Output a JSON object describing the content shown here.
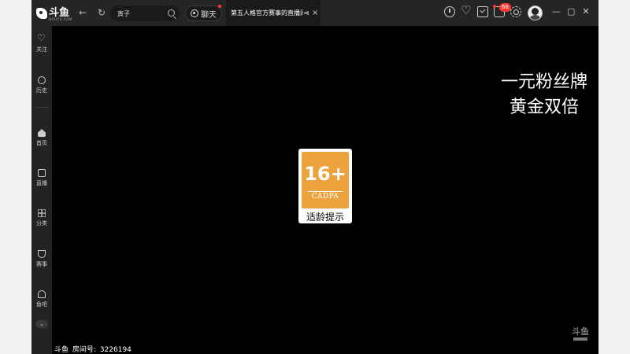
{
  "app": {
    "logo_text": "斗鱼",
    "logo_sub": "DOUYU.COM"
  },
  "nav": {
    "back_icon": "arrow-left",
    "refresh_icon": "refresh"
  },
  "search": {
    "value": "寅子",
    "icon": "search-icon"
  },
  "chat": {
    "label": "聊天"
  },
  "tab": {
    "title": "第五人格官方赛事的直播间",
    "close": "×"
  },
  "toolbar": {
    "icons": [
      "clock-icon",
      "heart-icon",
      "task-icon",
      "message-icon",
      "gear-icon"
    ],
    "message_badge": "66"
  },
  "window_controls": {
    "minimize": "—",
    "maximize": "▢",
    "close": "✕"
  },
  "sidebar": {
    "items": [
      {
        "label": "关注",
        "icon": "heart-icon"
      },
      {
        "label": "历史",
        "icon": "clock-icon"
      },
      {
        "label": "首页",
        "icon": "home-icon"
      },
      {
        "label": "直播",
        "icon": "tv-icon"
      },
      {
        "label": "分类",
        "icon": "grid-icon"
      },
      {
        "label": "赛事",
        "icon": "trophy-icon"
      },
      {
        "label": "鱼吧",
        "icon": "fishbar-icon"
      }
    ],
    "more": "⌄",
    "collapse": "‹"
  },
  "player": {
    "promo_line1": "一元粉丝牌",
    "promo_line2": "黄金双倍",
    "rating": {
      "age": "16+",
      "org": "CADPA",
      "tip": "适龄提示",
      "color": "#eca33d"
    },
    "room_brand": "斗鱼",
    "room_label": "房间号:",
    "room_number": "3226194",
    "watermark": "斗鱼"
  }
}
